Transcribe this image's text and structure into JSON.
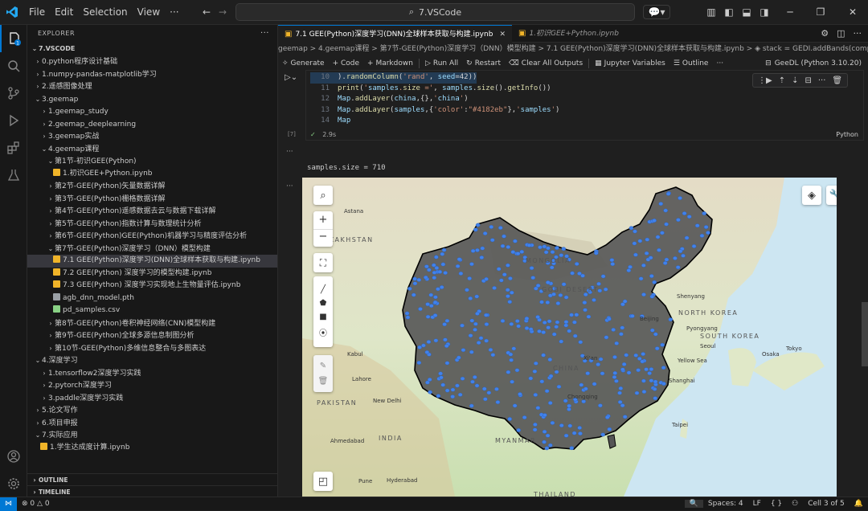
{
  "titlebar": {
    "menus": [
      "File",
      "Edit",
      "Selection",
      "View",
      "···"
    ],
    "search_text": "7.VSCode"
  },
  "sidebar": {
    "title": "EXPLORER",
    "root": "7.VSCODE",
    "items": [
      {
        "label": "0.python程序设计基础",
        "indent": 0,
        "kind": "folder-closed"
      },
      {
        "label": "1.numpy-pandas-matplotlib学习",
        "indent": 0,
        "kind": "folder-closed"
      },
      {
        "label": "2.遥感图像处理",
        "indent": 0,
        "kind": "folder-closed"
      },
      {
        "label": "3.geemap",
        "indent": 0,
        "kind": "folder-open"
      },
      {
        "label": "1.geemap_study",
        "indent": 1,
        "kind": "folder-closed"
      },
      {
        "label": "2.geemap_deeplearning",
        "indent": 1,
        "kind": "folder-closed"
      },
      {
        "label": "3.geemap实战",
        "indent": 1,
        "kind": "folder-closed"
      },
      {
        "label": "4.geemap课程",
        "indent": 1,
        "kind": "folder-open"
      },
      {
        "label": "第1节-初识GEE(Python)",
        "indent": 2,
        "kind": "folder-open"
      },
      {
        "label": "1.初识GEE+Python.ipynb",
        "indent": 3,
        "kind": "notebook"
      },
      {
        "label": "第2节-GEE(Python)矢量数据详解",
        "indent": 2,
        "kind": "folder-closed"
      },
      {
        "label": "第3节-GEE(Python)栅格数据详解",
        "indent": 2,
        "kind": "folder-closed"
      },
      {
        "label": "第4节-GEE(Python)遥感数据去云与数据下载详解",
        "indent": 2,
        "kind": "folder-closed"
      },
      {
        "label": "第5节-GEE(Python)指数计算与数理统计分析",
        "indent": 2,
        "kind": "folder-closed"
      },
      {
        "label": "第6节-GEE(Python)GEE(Python)机器学习与精度评估分析",
        "indent": 2,
        "kind": "folder-closed"
      },
      {
        "label": "第7节-GEE(Python)深度学习（DNN）模型构建",
        "indent": 2,
        "kind": "folder-open"
      },
      {
        "label": "7.1 GEE(Python)深度学习(DNN)全球样本获取与构建.ipynb",
        "indent": 3,
        "kind": "notebook",
        "selected": true
      },
      {
        "label": "7.2 GEE(Python) 深度学习的模型构建.ipynb",
        "indent": 3,
        "kind": "notebook"
      },
      {
        "label": "7.3 GEE(Python) 深度学习实现地上生物量评估.ipynb",
        "indent": 3,
        "kind": "notebook"
      },
      {
        "label": "agb_dnn_model.pth",
        "indent": 3,
        "kind": "file"
      },
      {
        "label": "pd_samples.csv",
        "indent": 3,
        "kind": "csv"
      },
      {
        "label": "第8节-GEE(Python)卷积神经网络(CNN)模型构建",
        "indent": 2,
        "kind": "folder-closed"
      },
      {
        "label": "第9节-GEE(Python)全球多源信息制图分析",
        "indent": 2,
        "kind": "folder-closed"
      },
      {
        "label": "第10节-GEE(Python)多维信息整合与多图表达",
        "indent": 2,
        "kind": "folder-closed"
      },
      {
        "label": "4.深度学习",
        "indent": 0,
        "kind": "folder-open"
      },
      {
        "label": "1.tensorflow2深度学习实践",
        "indent": 1,
        "kind": "folder-closed"
      },
      {
        "label": "2.pytorch深度学习",
        "indent": 1,
        "kind": "folder-closed"
      },
      {
        "label": "3.paddle深度学习实践",
        "indent": 1,
        "kind": "folder-closed"
      },
      {
        "label": "5.论文写作",
        "indent": 0,
        "kind": "folder-closed"
      },
      {
        "label": "6.项目申报",
        "indent": 0,
        "kind": "folder-closed"
      },
      {
        "label": "7.实际应用",
        "indent": 0,
        "kind": "folder-open"
      },
      {
        "label": "1.学生达成度计算.ipynb",
        "indent": 1,
        "kind": "notebook"
      }
    ],
    "outline_label": "OUTLINE",
    "timeline_label": "TIMELINE"
  },
  "editor": {
    "tabs": [
      {
        "label": "7.1 GEE(Python)深度学习(DNN)全球样本获取与构建.ipynb",
        "active": true
      },
      {
        "label": "1.初识GEE+Python.ipynb",
        "active": false
      }
    ],
    "breadcrumb": "geemap > 4.geemap课程 > 第7节-GEE(Python)深度学习（DNN）模型构建 > 7.1 GEE(Python)深度学习(DNN)全球样本获取与构建.ipynb > ◈ stack = GEDI.addBands(composite)",
    "toolbar": {
      "generate": "Generate",
      "code": "+ Code",
      "markdown": "+ Markdown",
      "run_all": "Run All",
      "restart": "Restart",
      "clear_outputs": "Clear All Outputs",
      "variables": "Jupyter Variables",
      "outline": "Outline",
      "kernel": "GeeDL (Python 3.10.20)"
    },
    "cell": {
      "exec_count": "[7]",
      "time": "2.9s",
      "language": "Python",
      "lines": [
        {
          "n": "10",
          "text": ").randomColumn('rand', seed=42))"
        },
        {
          "n": "11",
          "text": "print('samples.size =', samples.size().getInfo())"
        },
        {
          "n": "12",
          "text": "Map.addLayer(china,{},'china')"
        },
        {
          "n": "13",
          "text": "Map.addLayer(samples,{'color':\"#4182eb\"},'samples')"
        },
        {
          "n": "14",
          "text": "Map"
        }
      ]
    },
    "output_text": "samples.size = 710",
    "map": {
      "places": [
        "Astana",
        "KAZAKHSTAN",
        "MONGOLIA",
        "GOBI DESERT",
        "Shenyang",
        "Beijing",
        "Pyongyang",
        "NORTH KOREA",
        "SOUTH KOREA",
        "Seoul",
        "Osaka",
        "Tokyo",
        "Kabul",
        "Lahore",
        "New Delhi",
        "PAKISTAN",
        "INDIA",
        "Ahmedabad",
        "Pune",
        "Hyderabad",
        "Shanghai",
        "Taipei",
        "Chongqing",
        "MYANMAR",
        "THAILAND",
        "Yellow Sea",
        "CHINA",
        "Xi'an"
      ],
      "sample_color": "#4182eb",
      "china_fill": "#5a5a5a"
    }
  },
  "statusbar": {
    "errors": "0",
    "warnings": "0",
    "spaces": "Spaces: 4",
    "eol": "LF",
    "braces": "{ }",
    "cell": "Cell 3 of 5"
  },
  "colors": {
    "accent": "#0078d4",
    "bg": "#1f1f1f",
    "sidebar_bg": "#181818"
  }
}
